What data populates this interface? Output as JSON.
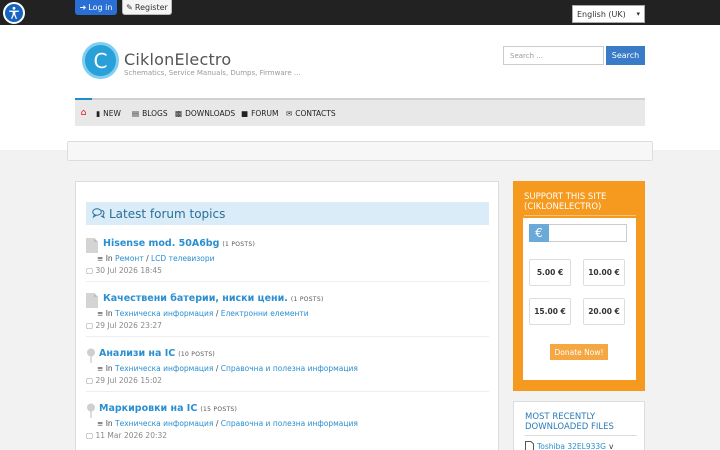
{
  "topbar": {
    "login_label": "Log in",
    "register_label": "Register",
    "language": "English (UK)"
  },
  "header": {
    "logo_letter": "C",
    "site_name": "CiklonElectro",
    "tagline": "Schematics, Service Manuals, Dumps, Firmware ...",
    "search_placeholder": "Search ...",
    "search_button": "Search"
  },
  "nav": {
    "items": [
      {
        "label": "NEW",
        "icon": "chart-icon"
      },
      {
        "label": "BLOGS",
        "icon": "list-icon"
      },
      {
        "label": "DOWNLOADS",
        "icon": "download-icon"
      },
      {
        "label": "FORUM",
        "icon": "comment-icon"
      },
      {
        "label": "CONTACTS",
        "icon": "envelope-icon"
      }
    ]
  },
  "forum": {
    "heading": "Latest forum topics",
    "topics": [
      {
        "title": "Hisense mod. 50A6bg",
        "posts": "(1 POSTS)",
        "in_label": "In",
        "category": "Ремонт",
        "subcategory": "LCD телевизори",
        "date": "30 Jul 2026 18:45",
        "icon": "file-icon"
      },
      {
        "title": "Качествени батерии, ниски цени.",
        "posts": "(1 POSTS)",
        "in_label": "In",
        "category": "Техническа информация",
        "subcategory": "Електронни елементи",
        "date": "29 Jul 2026 23:27",
        "icon": "file-icon"
      },
      {
        "title": "Анализи на IC",
        "posts": "(10 POSTS)",
        "in_label": "In",
        "category": "Техническа информация",
        "subcategory": "Справочна и полезна информация",
        "date": "29 Jul 2026 15:02",
        "icon": "pin-icon"
      },
      {
        "title": "Маркировки на IC",
        "posts": "(15 POSTS)",
        "in_label": "In",
        "category": "Техническа информация",
        "subcategory": "Справочна и полезна информация",
        "date": "11 Mar 2026 20:32",
        "icon": "pin-icon"
      }
    ]
  },
  "support": {
    "heading": "SUPPORT THIS SITE (CIKLONELECTRO)",
    "currency_symbol": "€",
    "amounts": [
      "5.00 €",
      "10.00 €",
      "15.00 €",
      "20.00 €"
    ],
    "donate_label": "Donate Now!"
  },
  "recent": {
    "heading": "MOST RECENTLY DOWNLOADED FILES",
    "item_link": "Toshiba 32EL933G",
    "item_tail": "v"
  },
  "colors": {
    "accent": "#2a8fd0",
    "support_bg": "#f59a1f",
    "topbar_bg": "#222222",
    "login_bg": "#2a6fd6"
  }
}
